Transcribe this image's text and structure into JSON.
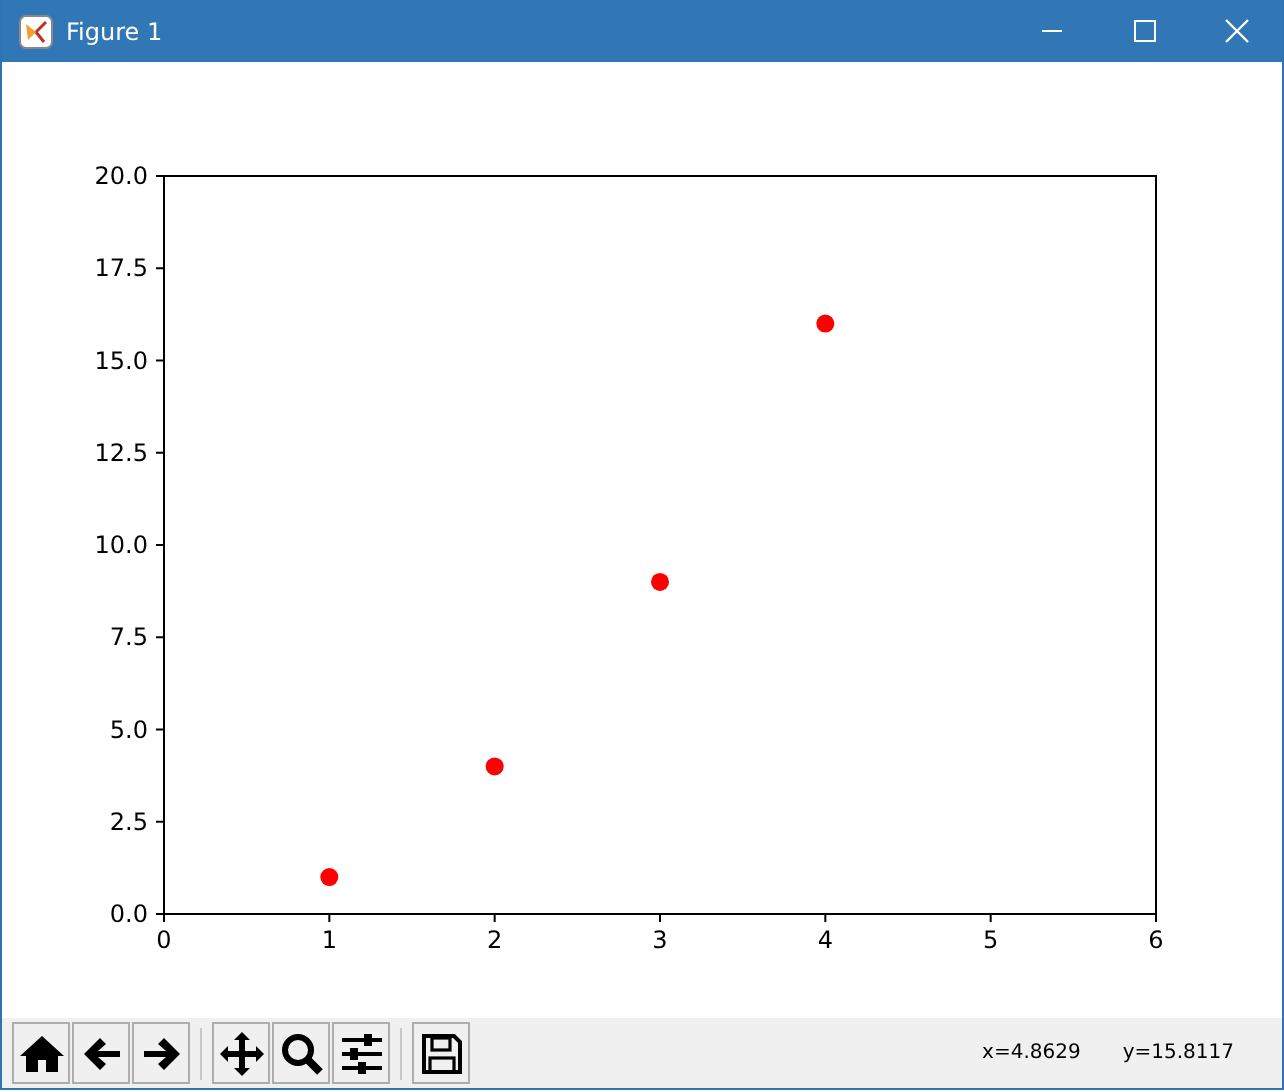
{
  "window": {
    "title": "Figure 1"
  },
  "chart_data": {
    "type": "scatter",
    "x": [
      1,
      2,
      3,
      4
    ],
    "series": [
      {
        "color": "#ff0000",
        "values": [
          1,
          4,
          9,
          16
        ]
      }
    ],
    "xlim": [
      0,
      6
    ],
    "ylim": [
      0,
      20
    ],
    "xticks": [
      0,
      1,
      2,
      3,
      4,
      5,
      6
    ],
    "yticks": [
      {
        "value": 0,
        "label": "0.0"
      },
      {
        "value": 2.5,
        "label": "2.5"
      },
      {
        "value": 5,
        "label": "5.0"
      },
      {
        "value": 7.5,
        "label": "7.5"
      },
      {
        "value": 10,
        "label": "10.0"
      },
      {
        "value": 12.5,
        "label": "12.5"
      },
      {
        "value": 15,
        "label": "15.0"
      },
      {
        "value": 17.5,
        "label": "17.5"
      },
      {
        "value": 20,
        "label": "20.0"
      }
    ]
  },
  "toolbar": {
    "buttons": [
      {
        "kind": "home"
      },
      {
        "kind": "back"
      },
      {
        "kind": "forward"
      },
      {
        "kind": "sep"
      },
      {
        "kind": "pan"
      },
      {
        "kind": "zoom"
      },
      {
        "kind": "configure"
      },
      {
        "kind": "sep"
      },
      {
        "kind": "save"
      }
    ],
    "x_readout": "x=4.8629",
    "y_readout": "y=15.8117"
  }
}
